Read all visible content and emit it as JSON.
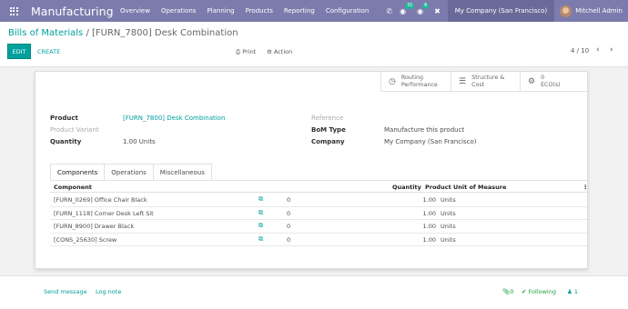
{
  "navbar": {
    "app_title": "Manufacturing",
    "menu": [
      "Overview",
      "Operations",
      "Planning",
      "Products",
      "Reporting",
      "Configuration"
    ],
    "messages_badge": "31",
    "activities_badge": "6",
    "company": "My Company (San Francisco)",
    "user": "Mitchell Admin"
  },
  "breadcrumb": {
    "parent": "Bills of Materials",
    "separator": "/",
    "current": "[FURN_7800] Desk Combination"
  },
  "buttons": {
    "edit": "EDIT",
    "create": "CREATE",
    "print": "Print",
    "action": "Action"
  },
  "pager": {
    "text": "4 / 10",
    "prev": "‹",
    "next": "›"
  },
  "smart_buttons": {
    "routing": [
      "Routing",
      "Performance"
    ],
    "structure": [
      "Structure &",
      "Cost"
    ],
    "eco_count": "0",
    "eco_label": "ECO(s)"
  },
  "form": {
    "product_label": "Product",
    "product_value": "[FURN_7800] Desk Combination",
    "variant_label": "Product Variant",
    "quantity_label": "Quantity",
    "quantity_value": "1.00 Units",
    "reference_label": "Reference",
    "bom_type_label": "BoM Type",
    "bom_type_value": "Manufacture this product",
    "company_label": "Company",
    "company_value": "My Company (San Francisco)"
  },
  "tabs": [
    "Components",
    "Operations",
    "Miscellaneous"
  ],
  "table": {
    "headers": {
      "component": "Component",
      "quantity": "Quantity",
      "uom": "Product Unit of Measure"
    },
    "rows": [
      {
        "component": "[FURN_0269] Office Chair Black",
        "count": "0",
        "quantity": "1.00",
        "uom": "Units"
      },
      {
        "component": "[FURN_1118] Corner Desk Left Sit",
        "count": "0",
        "quantity": "1.00",
        "uom": "Units"
      },
      {
        "component": "[FURN_8900] Drawer Black",
        "count": "0",
        "quantity": "1.00",
        "uom": "Units"
      },
      {
        "component": "[CONS_25630] Screw",
        "count": "0",
        "quantity": "1.00",
        "uom": "Units"
      }
    ]
  },
  "chatter": {
    "send_message": "Send message",
    "log_note": "Log note",
    "attachments": "0",
    "following": "Following",
    "followers": "1"
  },
  "colors": {
    "navbar": "#7c7bad",
    "accent": "#00a09d",
    "following": "#1a9c3a"
  }
}
